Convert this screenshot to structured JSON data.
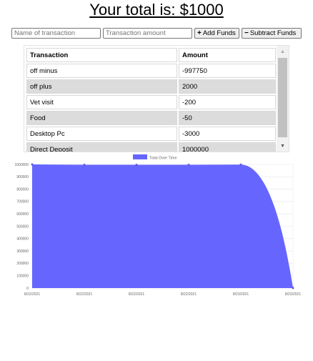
{
  "header": {
    "title": "Your total is: $1000"
  },
  "form": {
    "name_placeholder": "Name of transaction",
    "amount_placeholder": "Transaction amount",
    "add_label": "Add Funds",
    "subtract_label": "Subtract Funds"
  },
  "table": {
    "headers": [
      "Transaction",
      "Amount"
    ],
    "rows": [
      {
        "name": "off minus",
        "amount": "-997750"
      },
      {
        "name": "off plus",
        "amount": "2000"
      },
      {
        "name": "Vet visit",
        "amount": "-200"
      },
      {
        "name": "Food",
        "amount": "-50"
      },
      {
        "name": "Desktop Pc",
        "amount": "-3000"
      },
      {
        "name": "Direct Deposit",
        "amount": "1000000"
      }
    ]
  },
  "colors": {
    "area_fill": "#6666ff",
    "legend_swatch": "#6666ff"
  },
  "chart_data": {
    "type": "area",
    "title": "",
    "legend": "Total Over Time",
    "legend_placement": "top",
    "x": [
      "8/22/2021",
      "8/22/2021",
      "8/22/2021",
      "8/22/2021",
      "8/23/2021",
      "8/23/2021"
    ],
    "series": [
      {
        "name": "Total Over Time",
        "values": [
          1000000,
          997000,
          996950,
          996750,
          998750,
          1000
        ]
      }
    ],
    "yticks": [
      "0",
      "100000",
      "200000",
      "300000",
      "400000",
      "500000",
      "600000",
      "700000",
      "800000",
      "900000",
      "1000000"
    ],
    "ylim": [
      0,
      1000000
    ],
    "grid": true
  }
}
